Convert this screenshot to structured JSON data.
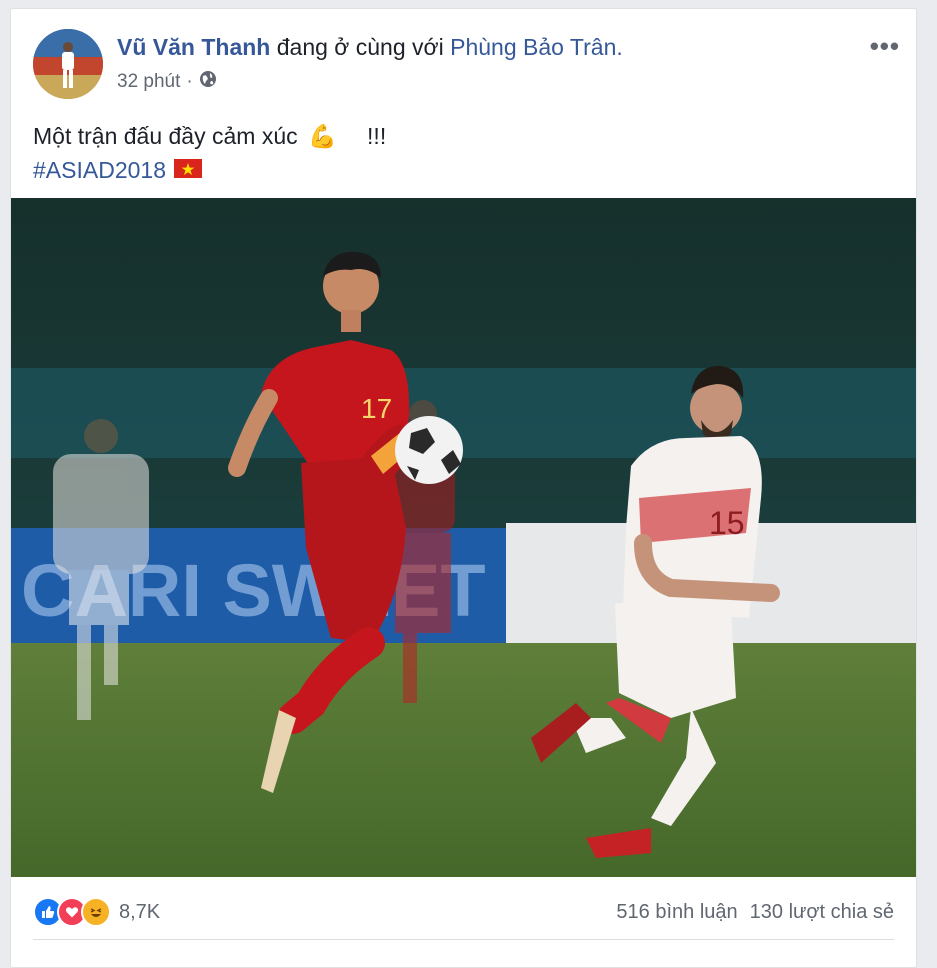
{
  "post": {
    "author": "Vũ Văn Thanh",
    "with_text": "đang ở cùng với",
    "tagged": "Phùng Bảo Trân.",
    "time": "32 phút",
    "dot": "·",
    "privacy_icon": "globe-icon",
    "more_label": "•••",
    "text_before_emoji": "Một trận đấu đầy cảm xúc",
    "emoji": "💪",
    "text_after_emoji": "!!!",
    "hashtag": "#ASIAD2018",
    "flag_icon": "vietnam-flag-icon"
  },
  "photo": {
    "jersey_red": "17",
    "jersey_white": "15",
    "board_text": "CARI SWEET"
  },
  "footer": {
    "reaction_icons": [
      "like-icon",
      "love-icon",
      "haha-icon"
    ],
    "reaction_count": "8,7K",
    "comments": "516 bình luận",
    "shares": "130 lượt chia sẻ"
  },
  "colors": {
    "link": "#365899",
    "meta": "#606770",
    "like": "#1877f2",
    "love": "#f33e58",
    "haha": "#f7b125"
  }
}
